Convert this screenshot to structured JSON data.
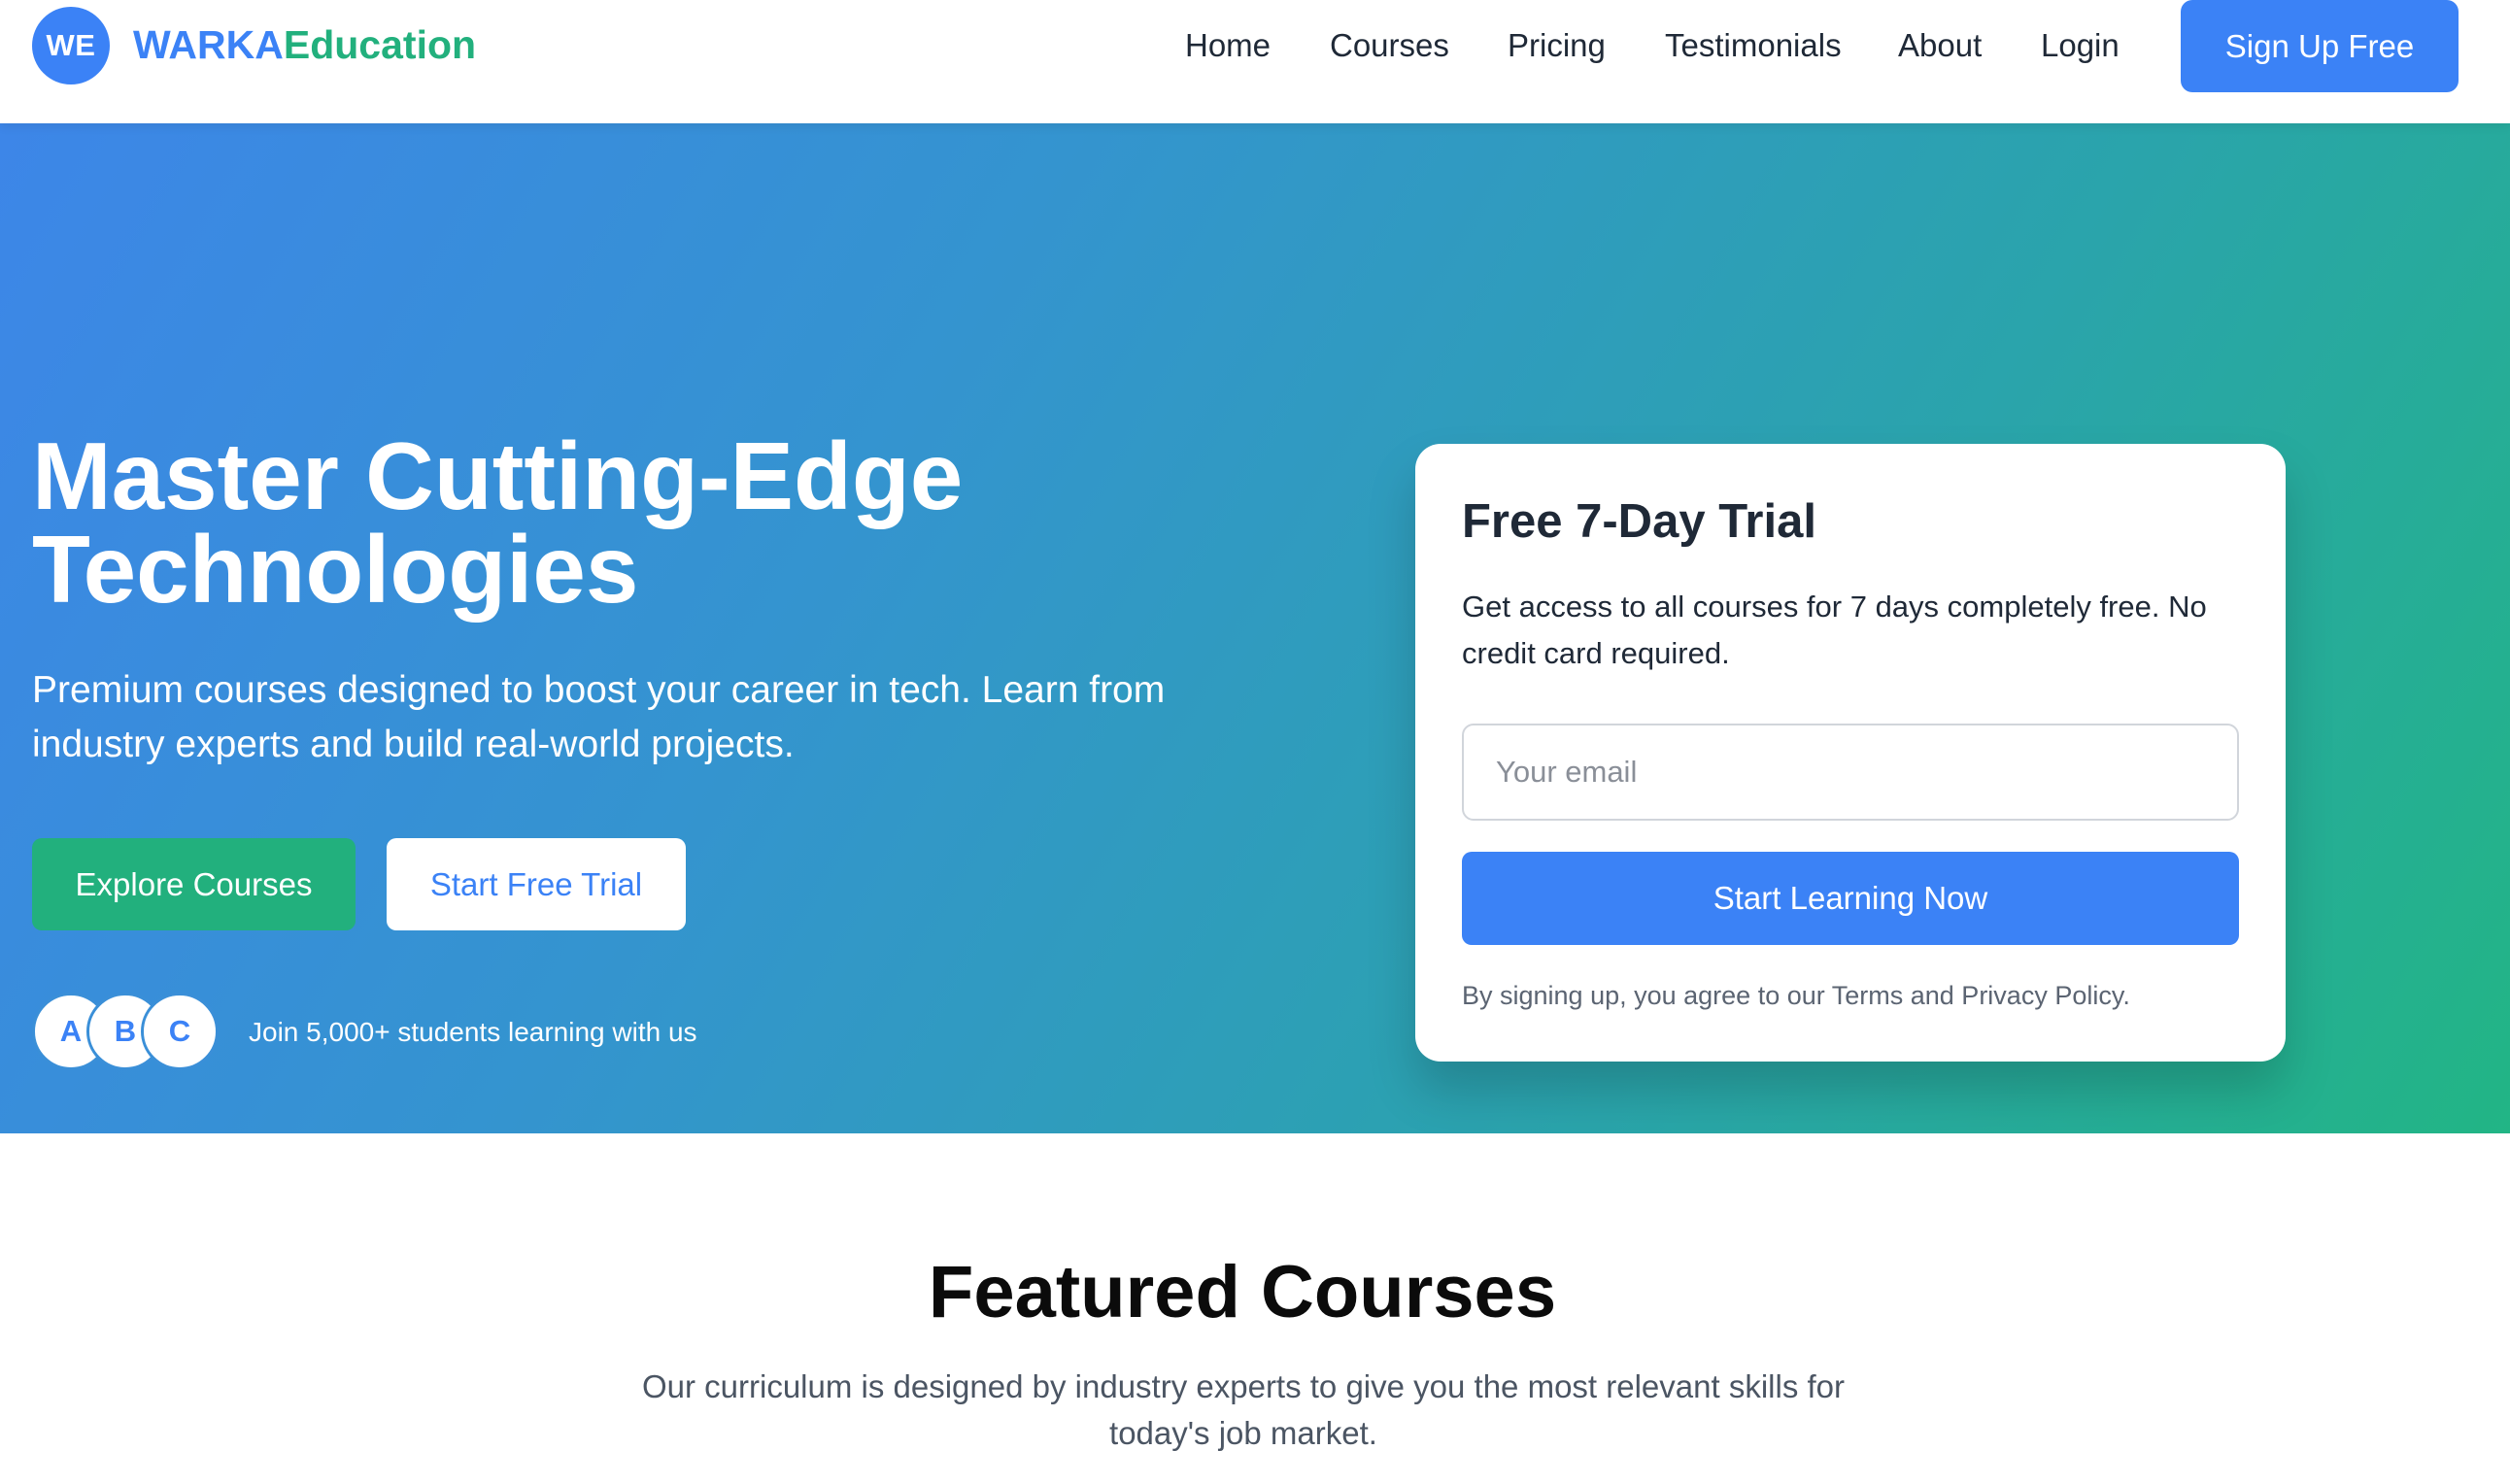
{
  "brand": {
    "badge": "WE",
    "name_part1": "WARKA",
    "name_part2": "Education",
    "primary_color": "#3b82f6",
    "secondary_color": "#22b07d"
  },
  "nav": {
    "items": [
      {
        "label": "Home"
      },
      {
        "label": "Courses"
      },
      {
        "label": "Pricing"
      },
      {
        "label": "Testimonials"
      },
      {
        "label": "About"
      },
      {
        "label": "Login"
      }
    ],
    "cta_label": "Sign Up Free"
  },
  "hero": {
    "title_line1": "Master Cutting-Edge",
    "title_line2": "Technologies",
    "subtitle": "Premium courses designed to boost your career in tech. Learn from industry experts and build real-world projects.",
    "primary_button": "Explore Courses",
    "secondary_button": "Start Free Trial",
    "avatars": [
      "A",
      "B",
      "C"
    ],
    "social_proof": "Join 5,000+ students learning with us"
  },
  "trial_card": {
    "title": "Free 7-Day Trial",
    "description": "Get access to all courses for 7 days completely free. No credit card required.",
    "email_placeholder": "Your email",
    "email_value": "",
    "submit_label": "Start Learning Now",
    "legal_text": "By signing up, you agree to our Terms and Privacy Policy."
  },
  "featured": {
    "title": "Featured Courses",
    "subtitle": "Our curriculum is designed by industry experts to give you the most relevant skills for today's job market."
  }
}
